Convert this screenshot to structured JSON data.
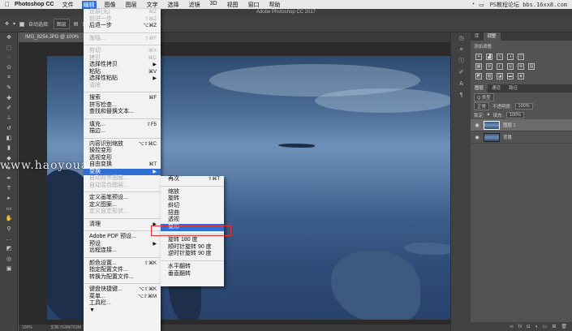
{
  "macbar": {
    "app_name": "Photoshop CC",
    "menus": [
      "文件",
      "编辑",
      "图像",
      "图层",
      "文字",
      "选择",
      "滤镜",
      "3D",
      "视图",
      "窗口",
      "帮助"
    ],
    "active_menu_index": 1,
    "watermark_text": "PS教程论坛 bbs.16xx8.com"
  },
  "window_title": "Adobe Photoshop CC 2017",
  "options_bar": {
    "auto_select_label": "自动选择:",
    "auto_select_value": "图层"
  },
  "document_tab": "IMG_8254.JPG @ 100% (图层...",
  "watermark": "www.haoyouansheji.com",
  "status": {
    "zoom": "100%",
    "doc": "文档:763M/763M"
  },
  "edit_menu": {
    "items": [
      {
        "label": "还原(无)",
        "shortcut": "⌘Z",
        "disabled": true
      },
      {
        "label": "前进一步",
        "shortcut": "⇧⌘Z",
        "disabled": true
      },
      {
        "label": "后退一步",
        "shortcut": "⌥⌘Z",
        "disabled": false
      },
      {
        "sep": true
      },
      {
        "label": "渐隐...",
        "shortcut": "⇧⌘F",
        "disabled": true
      },
      {
        "sep": true
      },
      {
        "label": "剪切",
        "shortcut": "⌘X",
        "disabled": true
      },
      {
        "label": "拷贝",
        "shortcut": "⌘C",
        "disabled": true
      },
      {
        "label": "选择性拷贝",
        "shortcut": "▶",
        "disabled": false
      },
      {
        "label": "粘贴",
        "shortcut": "⌘V",
        "disabled": false
      },
      {
        "label": "选择性粘贴",
        "shortcut": "▶",
        "disabled": false
      },
      {
        "label": "清除",
        "shortcut": "",
        "disabled": true
      },
      {
        "sep": true
      },
      {
        "label": "搜索",
        "shortcut": "⌘F",
        "disabled": false
      },
      {
        "label": "拼写检查...",
        "shortcut": "",
        "disabled": false
      },
      {
        "label": "查找和替换文本...",
        "shortcut": "",
        "disabled": false
      },
      {
        "sep": true
      },
      {
        "label": "填充...",
        "shortcut": "⇧F5",
        "disabled": false
      },
      {
        "label": "描边...",
        "shortcut": "",
        "disabled": false
      },
      {
        "sep": true
      },
      {
        "label": "内容识别缩放",
        "shortcut": "⌥⇧⌘C",
        "disabled": false
      },
      {
        "label": "操控变形",
        "shortcut": "",
        "disabled": false
      },
      {
        "label": "透视变形",
        "shortcut": "",
        "disabled": false
      },
      {
        "label": "自由变换",
        "shortcut": "⌘T",
        "disabled": false
      },
      {
        "label": "变换",
        "shortcut": "▶",
        "disabled": false,
        "selected": true
      },
      {
        "label": "自动对齐图层...",
        "shortcut": "",
        "disabled": true
      },
      {
        "label": "自动混合图层...",
        "shortcut": "",
        "disabled": true
      },
      {
        "sep": true
      },
      {
        "label": "定义画笔预设...",
        "shortcut": "",
        "disabled": false
      },
      {
        "label": "定义图案...",
        "shortcut": "",
        "disabled": false
      },
      {
        "label": "定义自定形状...",
        "shortcut": "",
        "disabled": true
      },
      {
        "sep": true
      },
      {
        "label": "清理",
        "shortcut": "▶",
        "disabled": false
      },
      {
        "sep": true
      },
      {
        "label": "Adobe PDF 预设...",
        "shortcut": "",
        "disabled": false
      },
      {
        "label": "预设",
        "shortcut": "▶",
        "disabled": false
      },
      {
        "label": "远程连接...",
        "shortcut": "",
        "disabled": false
      },
      {
        "sep": true
      },
      {
        "label": "颜色设置...",
        "shortcut": "⇧⌘K",
        "disabled": false
      },
      {
        "label": "指定配置文件...",
        "shortcut": "",
        "disabled": false
      },
      {
        "label": "转换为配置文件...",
        "shortcut": "",
        "disabled": false
      },
      {
        "sep": true
      },
      {
        "label": "键盘快捷键...",
        "shortcut": "⌥⇧⌘K",
        "disabled": false
      },
      {
        "label": "菜单...",
        "shortcut": "⌥⇧⌘M",
        "disabled": false
      },
      {
        "label": "工具栏...",
        "shortcut": "",
        "disabled": false
      },
      {
        "label": "▼",
        "shortcut": "",
        "disabled": false
      }
    ]
  },
  "transform_submenu": {
    "items": [
      {
        "label": "再次",
        "shortcut": "⇧⌘T"
      },
      {
        "sep": true
      },
      {
        "label": "缩放",
        "shortcut": ""
      },
      {
        "label": "旋转",
        "shortcut": ""
      },
      {
        "label": "斜切",
        "shortcut": ""
      },
      {
        "label": "扭曲",
        "shortcut": ""
      },
      {
        "label": "透视",
        "shortcut": ""
      },
      {
        "label": "变形",
        "shortcut": "",
        "selected": true
      },
      {
        "sep": true
      },
      {
        "label": "旋转 180 度",
        "shortcut": ""
      },
      {
        "label": "顺时针旋转 90 度",
        "shortcut": ""
      },
      {
        "label": "逆时针旋转 90 度",
        "shortcut": ""
      },
      {
        "sep": true
      },
      {
        "label": "水平翻转",
        "shortcut": ""
      },
      {
        "label": "垂直翻转",
        "shortcut": ""
      }
    ]
  },
  "panels": {
    "top_tabs": [
      "库",
      "调整"
    ],
    "adjust_title": "添加调整",
    "layer_tabs": [
      "图层",
      "通道",
      "路径"
    ],
    "kind_label": "Q 类型",
    "blend_mode": "正常",
    "opacity_label": "不透明度:",
    "opacity_value": "100%",
    "lock_label": "锁定:",
    "fill_label": "填充:",
    "fill_value": "100%",
    "layers": [
      {
        "name": "图层 1",
        "active": true
      },
      {
        "name": "背景",
        "active": false
      }
    ]
  }
}
